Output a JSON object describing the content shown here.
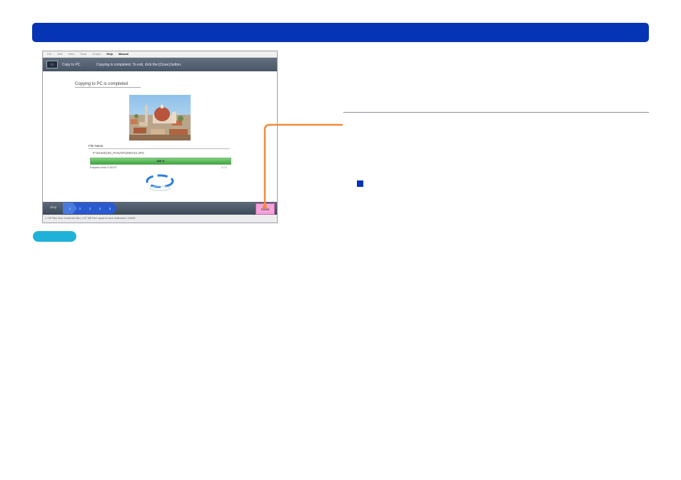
{
  "app": {
    "menu": [
      "File",
      "Edit",
      "View",
      "Tools",
      "Output",
      "Help",
      "Manual"
    ],
    "screen_title": "Copy to PC",
    "screen_message": "Copying is completed. To exit, click the [Close] button.",
    "completed_text": "Copying to PC is completed",
    "file_name_label": "File Name",
    "file_name": "P:\\DCIM\\100_PANA\\P1000734.JPG",
    "progress_percent": 100,
    "progress_label": "100 %",
    "elapsed": "Elapsed time 0:00:07",
    "count": "1 / 1",
    "step_label": "Step",
    "steps": [
      "1",
      "2",
      "3",
      "4",
      "5"
    ],
    "close_label": "Close",
    "status": "1 / 95 Files  Size of selected files: 4.07 MB  Free space at save destination: 1##GB"
  },
  "colors": {
    "title_bar": "#0535b5",
    "connector": "#f28a3c",
    "pill": "#1fb2d8",
    "bullet": "#0535b5"
  }
}
